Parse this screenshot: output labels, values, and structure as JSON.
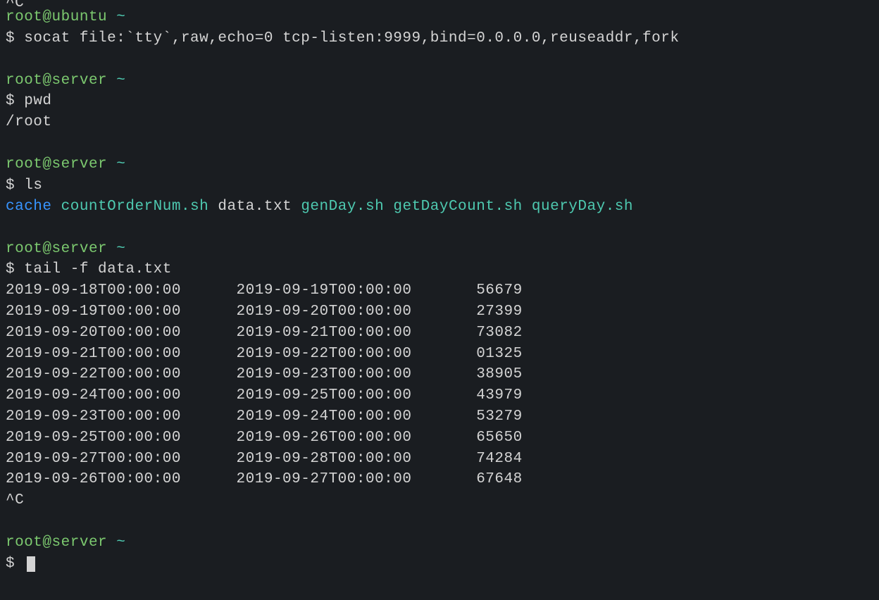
{
  "top_fragment": "^C",
  "blocks": [
    {
      "user": "root",
      "host": "ubuntu",
      "path": "~",
      "command": "socat file:`tty`,raw,echo=0 tcp-listen:9999,bind=0.0.0.0,reuseaddr,fork",
      "output_lines": []
    },
    {
      "user": "root",
      "host": "server",
      "path": "~",
      "command": "pwd",
      "output_lines": [
        "/root"
      ]
    },
    {
      "user": "root",
      "host": "server",
      "path": "~",
      "command": "ls",
      "ls_items": [
        {
          "name": "cache",
          "kind": "dir"
        },
        {
          "name": "countOrderNum.sh",
          "kind": "exec"
        },
        {
          "name": "data.txt",
          "kind": "file"
        },
        {
          "name": "genDay.sh",
          "kind": "exec"
        },
        {
          "name": "getDayCount.sh",
          "kind": "exec"
        },
        {
          "name": "queryDay.sh",
          "kind": "exec"
        }
      ]
    },
    {
      "user": "root",
      "host": "server",
      "path": "~",
      "command": "tail -f data.txt",
      "data_rows": [
        {
          "c1": "2019-09-18T00:00:00",
          "c2": "2019-09-19T00:00:00",
          "c3": "56679"
        },
        {
          "c1": "2019-09-19T00:00:00",
          "c2": "2019-09-20T00:00:00",
          "c3": "27399"
        },
        {
          "c1": "2019-09-20T00:00:00",
          "c2": "2019-09-21T00:00:00",
          "c3": "73082"
        },
        {
          "c1": "2019-09-21T00:00:00",
          "c2": "2019-09-22T00:00:00",
          "c3": "01325"
        },
        {
          "c1": "2019-09-22T00:00:00",
          "c2": "2019-09-23T00:00:00",
          "c3": "38905"
        },
        {
          "c1": "2019-09-24T00:00:00",
          "c2": "2019-09-25T00:00:00",
          "c3": "43979"
        },
        {
          "c1": "2019-09-23T00:00:00",
          "c2": "2019-09-24T00:00:00",
          "c3": "53279"
        },
        {
          "c1": "2019-09-25T00:00:00",
          "c2": "2019-09-26T00:00:00",
          "c3": "65650"
        },
        {
          "c1": "2019-09-27T00:00:00",
          "c2": "2019-09-28T00:00:00",
          "c3": "74284"
        },
        {
          "c1": "2019-09-26T00:00:00",
          "c2": "2019-09-27T00:00:00",
          "c3": "67648"
        }
      ],
      "interrupt": "^C"
    },
    {
      "user": "root",
      "host": "server",
      "path": "~",
      "command": "",
      "cursor": true
    }
  ],
  "ls_sep": "   "
}
